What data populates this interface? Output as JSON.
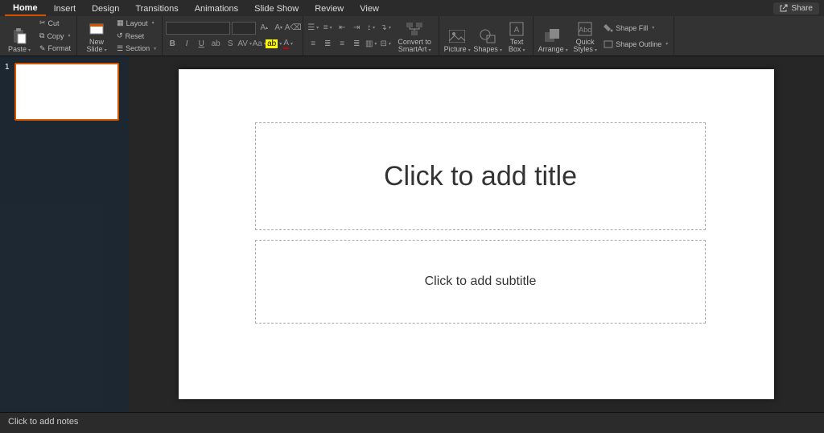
{
  "tabs": [
    "Home",
    "Insert",
    "Design",
    "Transitions",
    "Animations",
    "Slide Show",
    "Review",
    "View"
  ],
  "active_tab": "Home",
  "share": "Share",
  "clipboard": {
    "paste": "Paste",
    "cut": "Cut",
    "copy": "Copy",
    "format": "Format"
  },
  "slides": {
    "new_slide": "New\nSlide",
    "layout": "Layout",
    "reset": "Reset",
    "section": "Section"
  },
  "smartart": "Convert to\nSmartArt",
  "insert": {
    "picture": "Picture",
    "shapes": "Shapes",
    "textbox": "Text\nBox"
  },
  "arrange": "Arrange",
  "quick_styles": "Quick\nStyles",
  "shape_fill": "Shape Fill",
  "shape_outline": "Shape Outline",
  "thumb_number": "1",
  "title_placeholder": "Click to add title",
  "subtitle_placeholder": "Click to add subtitle",
  "notes_placeholder": "Click to add notes"
}
